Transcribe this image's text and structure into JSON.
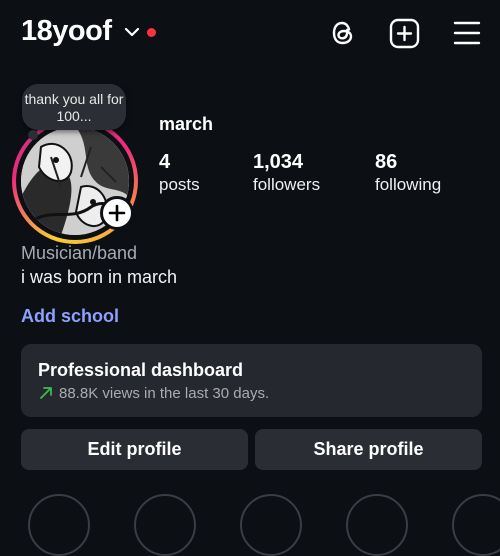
{
  "header": {
    "username": "18yoof",
    "notification_dot_color": "#ff3040",
    "icons": [
      "threads-icon",
      "create-plus-icon",
      "menu-icon"
    ]
  },
  "note": {
    "text": "thank you all for 100..."
  },
  "profile": {
    "full_name": "march",
    "stats": [
      {
        "value": "4",
        "label": "posts"
      },
      {
        "value": "1,034",
        "label": "followers"
      },
      {
        "value": "86",
        "label": "following"
      }
    ],
    "category": "Musician/band",
    "bio": "i was born in march",
    "add_school": "Add school"
  },
  "dashboard": {
    "title": "Professional dashboard",
    "subtitle": "88.8K views in the last 30 days.",
    "trend_color": "#3fb950"
  },
  "buttons": {
    "edit": "Edit profile",
    "share": "Share profile"
  },
  "colors": {
    "background": "#0c0f14",
    "link": "#8ea0ff",
    "card": "#25282e"
  }
}
